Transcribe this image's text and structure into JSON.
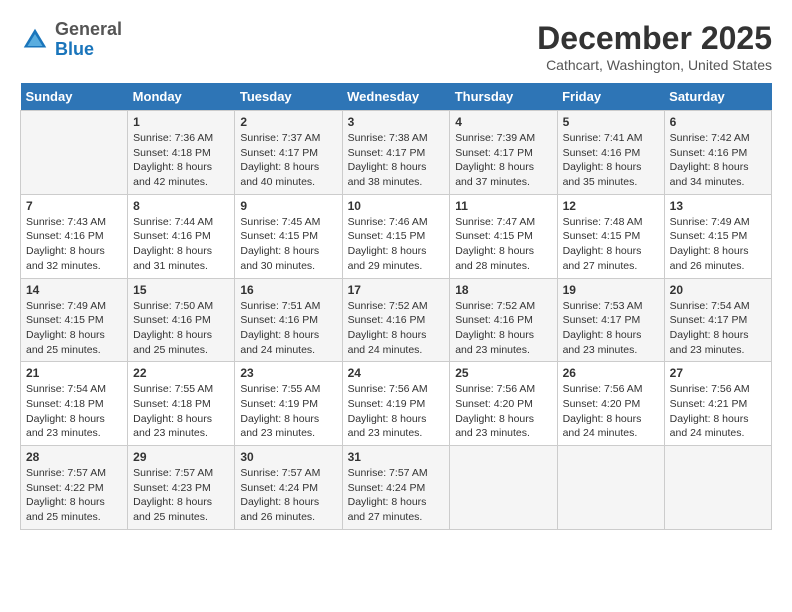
{
  "header": {
    "logo": {
      "general": "General",
      "blue": "Blue"
    },
    "title": "December 2025",
    "location": "Cathcart, Washington, United States"
  },
  "days_of_week": [
    "Sunday",
    "Monday",
    "Tuesday",
    "Wednesday",
    "Thursday",
    "Friday",
    "Saturday"
  ],
  "weeks": [
    [
      {
        "day": "",
        "sunrise": "",
        "sunset": "",
        "daylight": ""
      },
      {
        "day": "1",
        "sunrise": "Sunrise: 7:36 AM",
        "sunset": "Sunset: 4:18 PM",
        "daylight": "Daylight: 8 hours and 42 minutes."
      },
      {
        "day": "2",
        "sunrise": "Sunrise: 7:37 AM",
        "sunset": "Sunset: 4:17 PM",
        "daylight": "Daylight: 8 hours and 40 minutes."
      },
      {
        "day": "3",
        "sunrise": "Sunrise: 7:38 AM",
        "sunset": "Sunset: 4:17 PM",
        "daylight": "Daylight: 8 hours and 38 minutes."
      },
      {
        "day": "4",
        "sunrise": "Sunrise: 7:39 AM",
        "sunset": "Sunset: 4:17 PM",
        "daylight": "Daylight: 8 hours and 37 minutes."
      },
      {
        "day": "5",
        "sunrise": "Sunrise: 7:41 AM",
        "sunset": "Sunset: 4:16 PM",
        "daylight": "Daylight: 8 hours and 35 minutes."
      },
      {
        "day": "6",
        "sunrise": "Sunrise: 7:42 AM",
        "sunset": "Sunset: 4:16 PM",
        "daylight": "Daylight: 8 hours and 34 minutes."
      }
    ],
    [
      {
        "day": "7",
        "sunrise": "Sunrise: 7:43 AM",
        "sunset": "Sunset: 4:16 PM",
        "daylight": "Daylight: 8 hours and 32 minutes."
      },
      {
        "day": "8",
        "sunrise": "Sunrise: 7:44 AM",
        "sunset": "Sunset: 4:16 PM",
        "daylight": "Daylight: 8 hours and 31 minutes."
      },
      {
        "day": "9",
        "sunrise": "Sunrise: 7:45 AM",
        "sunset": "Sunset: 4:15 PM",
        "daylight": "Daylight: 8 hours and 30 minutes."
      },
      {
        "day": "10",
        "sunrise": "Sunrise: 7:46 AM",
        "sunset": "Sunset: 4:15 PM",
        "daylight": "Daylight: 8 hours and 29 minutes."
      },
      {
        "day": "11",
        "sunrise": "Sunrise: 7:47 AM",
        "sunset": "Sunset: 4:15 PM",
        "daylight": "Daylight: 8 hours and 28 minutes."
      },
      {
        "day": "12",
        "sunrise": "Sunrise: 7:48 AM",
        "sunset": "Sunset: 4:15 PM",
        "daylight": "Daylight: 8 hours and 27 minutes."
      },
      {
        "day": "13",
        "sunrise": "Sunrise: 7:49 AM",
        "sunset": "Sunset: 4:15 PM",
        "daylight": "Daylight: 8 hours and 26 minutes."
      }
    ],
    [
      {
        "day": "14",
        "sunrise": "Sunrise: 7:49 AM",
        "sunset": "Sunset: 4:15 PM",
        "daylight": "Daylight: 8 hours and 25 minutes."
      },
      {
        "day": "15",
        "sunrise": "Sunrise: 7:50 AM",
        "sunset": "Sunset: 4:16 PM",
        "daylight": "Daylight: 8 hours and 25 minutes."
      },
      {
        "day": "16",
        "sunrise": "Sunrise: 7:51 AM",
        "sunset": "Sunset: 4:16 PM",
        "daylight": "Daylight: 8 hours and 24 minutes."
      },
      {
        "day": "17",
        "sunrise": "Sunrise: 7:52 AM",
        "sunset": "Sunset: 4:16 PM",
        "daylight": "Daylight: 8 hours and 24 minutes."
      },
      {
        "day": "18",
        "sunrise": "Sunrise: 7:52 AM",
        "sunset": "Sunset: 4:16 PM",
        "daylight": "Daylight: 8 hours and 23 minutes."
      },
      {
        "day": "19",
        "sunrise": "Sunrise: 7:53 AM",
        "sunset": "Sunset: 4:17 PM",
        "daylight": "Daylight: 8 hours and 23 minutes."
      },
      {
        "day": "20",
        "sunrise": "Sunrise: 7:54 AM",
        "sunset": "Sunset: 4:17 PM",
        "daylight": "Daylight: 8 hours and 23 minutes."
      }
    ],
    [
      {
        "day": "21",
        "sunrise": "Sunrise: 7:54 AM",
        "sunset": "Sunset: 4:18 PM",
        "daylight": "Daylight: 8 hours and 23 minutes."
      },
      {
        "day": "22",
        "sunrise": "Sunrise: 7:55 AM",
        "sunset": "Sunset: 4:18 PM",
        "daylight": "Daylight: 8 hours and 23 minutes."
      },
      {
        "day": "23",
        "sunrise": "Sunrise: 7:55 AM",
        "sunset": "Sunset: 4:19 PM",
        "daylight": "Daylight: 8 hours and 23 minutes."
      },
      {
        "day": "24",
        "sunrise": "Sunrise: 7:56 AM",
        "sunset": "Sunset: 4:19 PM",
        "daylight": "Daylight: 8 hours and 23 minutes."
      },
      {
        "day": "25",
        "sunrise": "Sunrise: 7:56 AM",
        "sunset": "Sunset: 4:20 PM",
        "daylight": "Daylight: 8 hours and 23 minutes."
      },
      {
        "day": "26",
        "sunrise": "Sunrise: 7:56 AM",
        "sunset": "Sunset: 4:20 PM",
        "daylight": "Daylight: 8 hours and 24 minutes."
      },
      {
        "day": "27",
        "sunrise": "Sunrise: 7:56 AM",
        "sunset": "Sunset: 4:21 PM",
        "daylight": "Daylight: 8 hours and 24 minutes."
      }
    ],
    [
      {
        "day": "28",
        "sunrise": "Sunrise: 7:57 AM",
        "sunset": "Sunset: 4:22 PM",
        "daylight": "Daylight: 8 hours and 25 minutes."
      },
      {
        "day": "29",
        "sunrise": "Sunrise: 7:57 AM",
        "sunset": "Sunset: 4:23 PM",
        "daylight": "Daylight: 8 hours and 25 minutes."
      },
      {
        "day": "30",
        "sunrise": "Sunrise: 7:57 AM",
        "sunset": "Sunset: 4:24 PM",
        "daylight": "Daylight: 8 hours and 26 minutes."
      },
      {
        "day": "31",
        "sunrise": "Sunrise: 7:57 AM",
        "sunset": "Sunset: 4:24 PM",
        "daylight": "Daylight: 8 hours and 27 minutes."
      },
      {
        "day": "",
        "sunrise": "",
        "sunset": "",
        "daylight": ""
      },
      {
        "day": "",
        "sunrise": "",
        "sunset": "",
        "daylight": ""
      },
      {
        "day": "",
        "sunrise": "",
        "sunset": "",
        "daylight": ""
      }
    ]
  ]
}
